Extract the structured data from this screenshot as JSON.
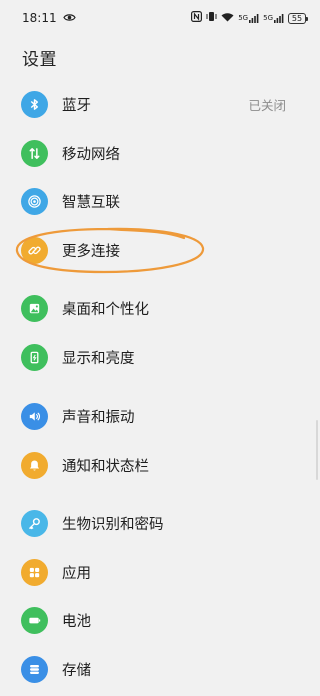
{
  "status_bar": {
    "time": "18:11",
    "network_1": "5G",
    "network_2": "5G",
    "battery": "55"
  },
  "page": {
    "title": "设置"
  },
  "settings": [
    {
      "label": "蓝牙",
      "value": "已关闭",
      "icon": "bluetooth-icon",
      "color": "#3fa7e6"
    },
    {
      "label": "移动网络",
      "icon": "mobile-data-icon",
      "color": "#3fbf5d"
    },
    {
      "label": "智慧互联",
      "icon": "smart-connect-icon",
      "color": "#3fa7e6"
    },
    {
      "label": "更多连接",
      "icon": "link-icon",
      "color": "#f1ab2f"
    },
    {
      "label": "桌面和个性化",
      "icon": "wallpaper-icon",
      "color": "#3fbf5d"
    },
    {
      "label": "显示和亮度",
      "icon": "display-brightness-icon",
      "color": "#3fbf5d"
    },
    {
      "label": "声音和振动",
      "icon": "sound-icon",
      "color": "#3a8fe6"
    },
    {
      "label": "通知和状态栏",
      "icon": "bell-icon",
      "color": "#f1ab2f"
    },
    {
      "label": "生物识别和密码",
      "icon": "key-icon",
      "color": "#49b7e8"
    },
    {
      "label": "应用",
      "icon": "apps-icon",
      "color": "#f1ab2f"
    },
    {
      "label": "电池",
      "icon": "battery-icon",
      "color": "#3fbf5d"
    },
    {
      "label": "存储",
      "icon": "storage-icon",
      "color": "#3a8fe6"
    }
  ],
  "annotation": {
    "color": "#ee9a3a"
  }
}
